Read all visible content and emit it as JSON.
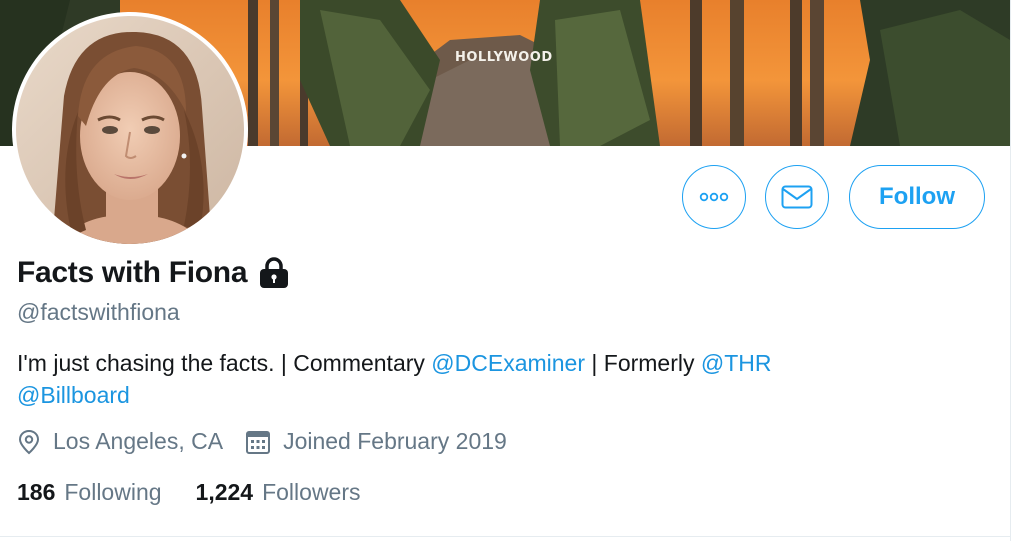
{
  "banner": {
    "sign_text": "HOLLYWOOD"
  },
  "profile": {
    "name": "Facts with Fiona",
    "handle": "@factswithfiona",
    "bio": {
      "text1": "I'm just chasing the facts. | Commentary ",
      "mention1": "@DCExaminer",
      "text2": " | Formerly ",
      "mention2": "@THR",
      "mention3": "@Billboard"
    },
    "location": "Los Angeles, CA",
    "joined": "Joined February 2019",
    "following_count": "186",
    "following_label": "Following",
    "followers_count": "1,224",
    "followers_label": "Followers"
  },
  "actions": {
    "more_icon": "more-icon",
    "message_icon": "envelope-icon",
    "follow_label": "Follow"
  },
  "icons": {
    "lock": "lock-icon",
    "location": "location-pin-icon",
    "calendar": "calendar-icon"
  },
  "colors": {
    "accent": "#1da1f2",
    "link": "#1b95e0",
    "secondary_text": "#657786",
    "primary_text": "#14171a"
  }
}
